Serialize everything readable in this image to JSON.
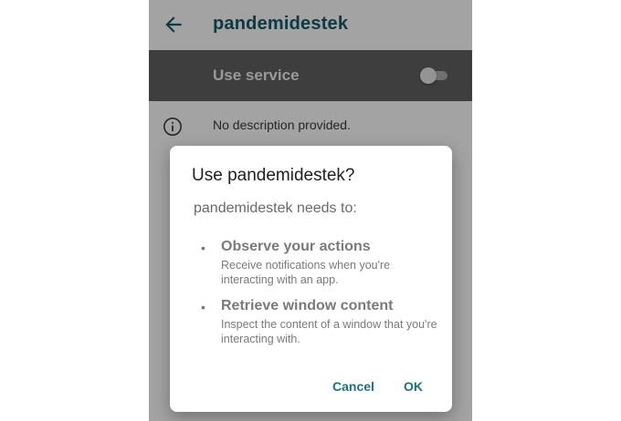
{
  "toolbar": {
    "back_icon": "arrow-back-icon",
    "title": "pandemidestek",
    "title_color": "#1a5a6a"
  },
  "service": {
    "label": "Use service",
    "toggle_on": false,
    "bar_color": "#616161"
  },
  "description": {
    "icon": "info-icon",
    "text": "No description provided."
  },
  "dialog": {
    "title": "Use pandemidestek?",
    "subtitle": "pandemidestek needs to:",
    "permissions": [
      {
        "title": "Observe your actions",
        "desc": "Receive notifications when you're interacting with an app."
      },
      {
        "title": "Retrieve window content",
        "desc": "Inspect the content of a window that you're interacting with."
      }
    ],
    "cancel_label": "Cancel",
    "ok_label": "OK",
    "accent_color": "#1f6f80"
  }
}
